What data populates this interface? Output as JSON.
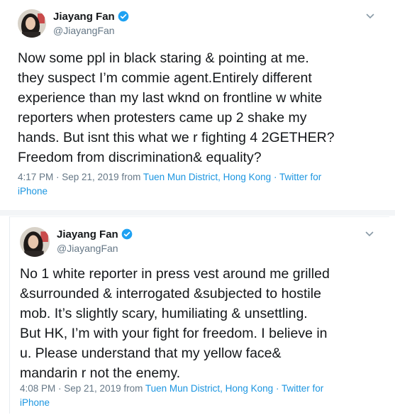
{
  "tweets": [
    {
      "author_name": "Jiayang Fan",
      "author_handle": "@JiayangFan",
      "text_lines": [
        "Now some ppl in black staring & pointing at me.",
        "they suspect I’m commie agent.Entirely different",
        "experience than my last wknd on frontline w white",
        "reporters when protesters came up 2 shake my",
        "hands. But isnt this what we r fighting 4 2GETHER?",
        "Freedom from discrimination& equality?"
      ],
      "time_date": "4:17 PM · Sep 21, 2019 from ",
      "location": "Tuen Mun District, Hong Kong",
      "source_line1": " · Twitter for",
      "source_line2": "iPhone"
    },
    {
      "author_name": "Jiayang Fan",
      "author_handle": "@JiayangFan",
      "text_lines": [
        "No 1 white reporter in press vest around me grilled",
        "&surrounded & interrogated &subjected to hostile",
        "mob. It’s slightly scary, humiliating & unsettling.",
        "But HK, I’m with your fight for freedom. I believe in",
        "u. Please understand that my yellow face&",
        "mandarin r not the enemy."
      ],
      "time_date": "4:08 PM · Sep 21, 2019 from ",
      "location": "Tuen Mun District, Hong Kong",
      "source_line1": " · Twitter for",
      "source_line2": "iPhone"
    }
  ],
  "colors": {
    "verified_badge": "#1da1f2",
    "link": "#1b95e0",
    "secondary_text": "#657786"
  },
  "icons": [
    "verified-badge-icon",
    "chevron-down-icon"
  ]
}
